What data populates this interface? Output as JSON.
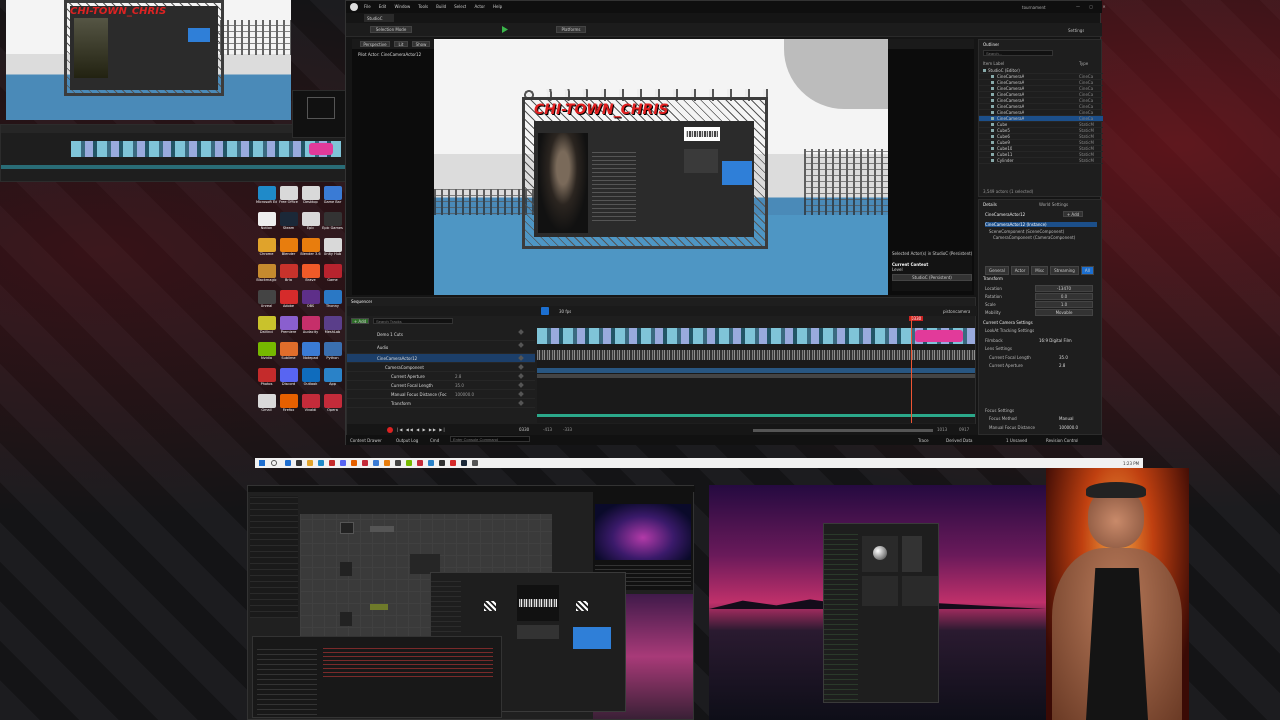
{
  "outliner": {
    "title": "Outliner",
    "search_placeholder": "Search...",
    "col_label": "Item Label",
    "col_type": "Type",
    "items": [
      {
        "label": "StudioC (Editor)",
        "type": ""
      },
      {
        "label": "CineCameraA",
        "type": "CineCa"
      },
      {
        "label": "CineCameraA",
        "type": "CineCa"
      },
      {
        "label": "CineCameraA",
        "type": "CineCa"
      },
      {
        "label": "CineCameraA",
        "type": "CineCa"
      },
      {
        "label": "CineCameraA",
        "type": "CineCa"
      },
      {
        "label": "CineCameraA",
        "type": "CineCa"
      },
      {
        "label": "CineCameraA",
        "type": "CineCa"
      },
      {
        "label": "CineCameraA",
        "type": "CineCa"
      },
      {
        "label": "Cube",
        "type": "StaticM"
      },
      {
        "label": "Cube5",
        "type": "StaticM"
      },
      {
        "label": "Cube6",
        "type": "StaticM"
      },
      {
        "label": "Cube9",
        "type": "StaticM"
      },
      {
        "label": "Cube10",
        "type": "StaticM"
      },
      {
        "label": "Cube11",
        "type": "StaticM"
      },
      {
        "label": "Cylinder",
        "type": "StaticM"
      }
    ],
    "footer": "3,549 actors (1 selected)"
  },
  "details": {
    "title": "Details",
    "tab2": "World Settings",
    "selected_name": "CineCameraActor12",
    "add_label": "+ Add",
    "component_root": "CineCameraActor12 (Instance)",
    "component_1": "SceneComponent (SceneComponent)",
    "component_2": "CameraComponent (CameraComponent)",
    "filters": [
      "General",
      "Actor",
      "Misc",
      "Streaming",
      "All"
    ],
    "transform_label": "Transform",
    "fields": [
      {
        "label": "Location",
        "value": "-13470"
      },
      {
        "label": "Rotation",
        "value": "0.0"
      },
      {
        "label": "Scale",
        "value": "1.0"
      },
      {
        "label": "Mobility",
        "value": "Movable"
      }
    ],
    "current_camera": "Current Camera Settings",
    "lookat": "LookAt Tracking Settings",
    "filmback": "Filmback",
    "filmback_val": "16:9 Digital Film",
    "lens": "Lens Settings",
    "focal": "Current Focal Length",
    "focal_val": "35.0",
    "aperture": "Current Aperture",
    "aperture_val": "2.8",
    "focus": "Focus Settings",
    "focus_method": "Focus Method",
    "focus_method_val": "Manual",
    "manual_focus": "Manual Focus Distance",
    "manual_focus_val": "100000.0"
  },
  "viewport": {
    "mode": "Perspective",
    "lit": "Lit",
    "show": "Show",
    "tag": "Sequencer",
    "pilot": "Pilot Actor: CineCameraActor12",
    "banner": "CHI-TOWN_CHRIS",
    "selected_info": "Selected Actor(s) in StudioC (Persistent)",
    "current_context": "Current Context",
    "level": "Level",
    "level_val": "StudioC (Persistent)"
  },
  "toolbar": {
    "menu": [
      "File",
      "Edit",
      "Window",
      "Tools",
      "Build",
      "Select",
      "Actor",
      "Help"
    ],
    "project": "StudioC",
    "selection_mode": "Selection Mode",
    "platforms": "Platforms",
    "settings": "Settings",
    "window_title": "tournament"
  },
  "sequencer": {
    "tab": "Sequencer",
    "add": "+ Add",
    "search_placeholder": "Search Tracks",
    "fps": "30 fps",
    "current_frame": "0330",
    "tracks": [
      {
        "label": "Demo 1 Cuts",
        "value": ""
      },
      {
        "label": "Audio",
        "value": ""
      },
      {
        "label": "CineCameraActor12",
        "value": ""
      },
      {
        "label": "CameraComponent",
        "value": ""
      },
      {
        "label": "Current Aperture",
        "value": "2.8"
      },
      {
        "label": "Current Focal Length",
        "value": "35.0"
      },
      {
        "label": "Manual Focus Distance (Foc",
        "value": "100000.0"
      },
      {
        "label": "Transform",
        "value": ""
      }
    ],
    "footer_left": "0330",
    "footer_mid_1": "-413",
    "footer_mid_2": "-333",
    "footer_right_1": "1013",
    "footer_right_2": "0917",
    "sequence_name": "pistoncamera"
  },
  "statusbar": {
    "content_drawer": "Content Drawer",
    "output_log": "Output Log",
    "cmd": "Cmd",
    "cmd_placeholder": "Enter Console Command",
    "trace": "Trace",
    "derived": "Derived Data",
    "unsaved": "1 Unsaved",
    "revision": "Revision Control"
  },
  "desktop_icons": [
    {
      "label": "Microsoft Edge",
      "color": "#1f8ac9"
    },
    {
      "label": "Free Office",
      "color": "#d9d9d9"
    },
    {
      "label": "Desktop",
      "color": "#d9d9d9"
    },
    {
      "label": "Game Bar",
      "color": "#3a7bd5"
    },
    {
      "label": "Notion",
      "color": "#eeeeee"
    },
    {
      "label": "Steam",
      "color": "#1b2838"
    },
    {
      "label": "Epic",
      "color": "#d9d9d9"
    },
    {
      "label": "Epic Games",
      "color": "#333333"
    },
    {
      "label": "Chrome",
      "color": "#e0a32b"
    },
    {
      "label": "Blender",
      "color": "#e87d0d"
    },
    {
      "label": "Blender 3.6",
      "color": "#e87d0d"
    },
    {
      "label": "Unity Hub",
      "color": "#d9d9d9"
    },
    {
      "label": "Blackmagic",
      "color": "#c68a2e"
    },
    {
      "label": "Bria",
      "color": "#c8322b"
    },
    {
      "label": "Brave",
      "color": "#f05a28"
    },
    {
      "label": "Game",
      "color": "#b7232e"
    },
    {
      "label": "Unreal",
      "color": "#444444"
    },
    {
      "label": "Adobe",
      "color": "#d62b2b"
    },
    {
      "label": "OBS",
      "color": "#5e2f89"
    },
    {
      "label": "Thonny",
      "color": "#2a78c5"
    },
    {
      "label": "DaVinci",
      "color": "#c9c22c"
    },
    {
      "label": "Premiere",
      "color": "#8a5fce"
    },
    {
      "label": "Audacity",
      "color": "#c62f6a"
    },
    {
      "label": "MeshLab",
      "color": "#5a3e8a"
    },
    {
      "label": "Nvidia",
      "color": "#76b900"
    },
    {
      "label": "Sublime",
      "color": "#e06d2b"
    },
    {
      "label": "Notepad",
      "color": "#3a7bd5"
    },
    {
      "label": "Python",
      "color": "#3a6fb0"
    },
    {
      "label": "Photos",
      "color": "#c42b2b"
    },
    {
      "label": "Discord",
      "color": "#5865f2"
    },
    {
      "label": "Outlook",
      "color": "#0f6cbd"
    },
    {
      "label": "App",
      "color": "#2a82c8"
    },
    {
      "label": "Gmail",
      "color": "#d9d9d9"
    },
    {
      "label": "Firefox",
      "color": "#e66000"
    },
    {
      "label": "Vivaldi",
      "color": "#c42b3a"
    },
    {
      "label": "Opera",
      "color": "#c42b3a"
    }
  ],
  "taskbar": {
    "time": "1:23 PM"
  }
}
